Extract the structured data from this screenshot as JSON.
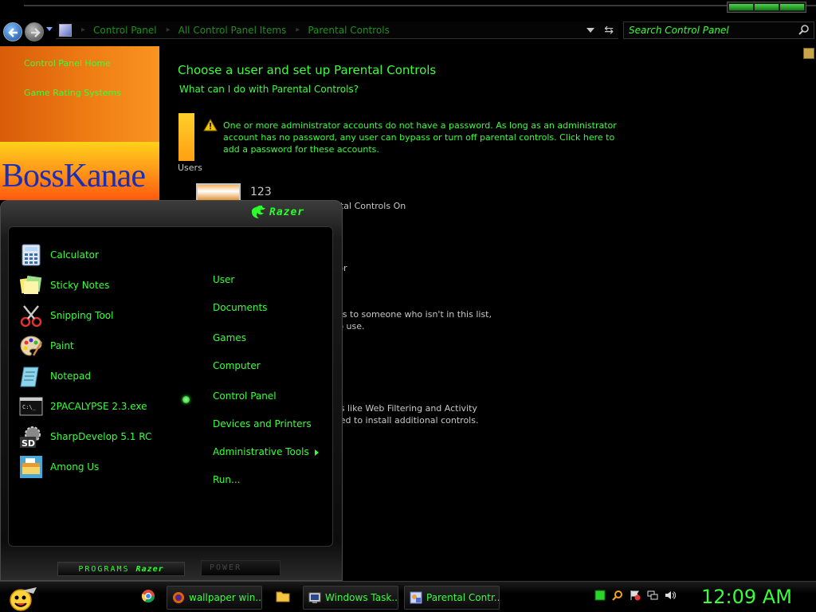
{
  "address_bar": {
    "breadcrumbs": [
      "Control Panel",
      "All Control Panel Items",
      "Parental Controls"
    ],
    "search_placeholder": "Search Control Panel"
  },
  "sidebar": {
    "links": [
      "Control Panel Home",
      "Game Rating Systems"
    ],
    "banner_text": "BossKanae"
  },
  "main": {
    "heading": "Choose a user and set up Parental Controls",
    "help_link": "What can I do with Parental Controls?",
    "users_label": "Users",
    "warning": "One or more administrator accounts do not have a password. As long as an administrator account has no password, any user can bypass or turn off parental controls. Click here to add a password for these accounts.",
    "user_name": "123",
    "background_fragments": [
      "ntal Controls On",
      "tor",
      "ols to someone who isn't in this list,",
      "to use.",
      "es like Web Filtering and Activity",
      "eed to install additional controls.",
      "?"
    ]
  },
  "start_menu": {
    "brand": "Razer",
    "programs": [
      {
        "label": "Calculator",
        "icon": "calculator-icon"
      },
      {
        "label": "Sticky Notes",
        "icon": "sticky-notes-icon"
      },
      {
        "label": "Snipping Tool",
        "icon": "scissors-icon"
      },
      {
        "label": "Paint",
        "icon": "paint-palette-icon"
      },
      {
        "label": "Notepad",
        "icon": "notepad-icon"
      },
      {
        "label": "2PACALYPSE 2.3.exe",
        "icon": "console-icon"
      },
      {
        "label": "SharpDevelop 5.1 RC",
        "icon": "sharpdevelop-icon"
      },
      {
        "label": "Among Us",
        "icon": "game-icon"
      }
    ],
    "places": [
      "User",
      "Documents",
      "Games",
      "Computer",
      "Control Panel",
      "Devices and Printers",
      "Administrative Tools",
      "Run..."
    ],
    "programs_button": "PROGRAMS",
    "programs_brand": "Razer",
    "power_button": "POWER"
  },
  "taskbar": {
    "tasks": [
      {
        "label": "wallpaper win...",
        "icon": "firefox-icon"
      },
      {
        "label": "Windows Task...",
        "icon": "task-manager-icon"
      },
      {
        "label": "Parental Contr...",
        "icon": "control-panel-icon"
      }
    ],
    "clock": "12:09 AM"
  },
  "colors": {
    "accent_green": "#39ff3a",
    "orange_pane": "#f07f15",
    "banner_blue": "#1a2fb8"
  }
}
